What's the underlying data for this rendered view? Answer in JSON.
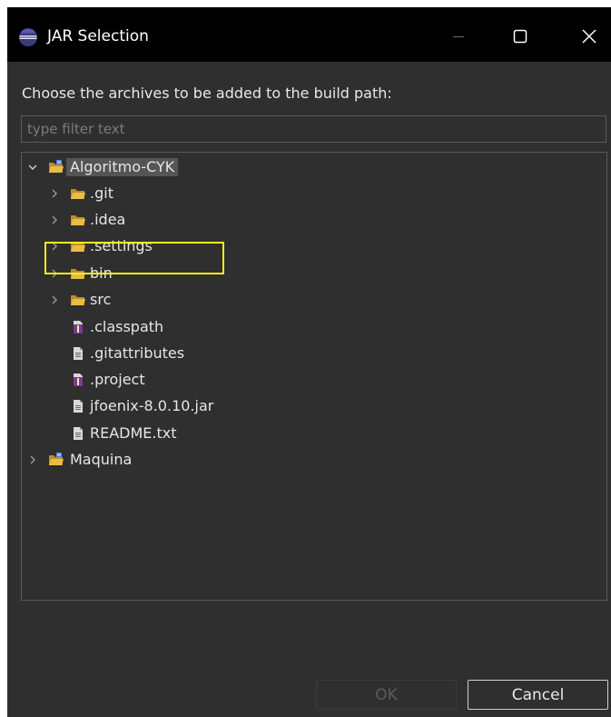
{
  "window": {
    "title": "JAR Selection",
    "minimize_icon": "minimize-icon",
    "maximize_icon": "maximize-icon",
    "close_icon": "close-icon"
  },
  "dialog": {
    "instruction": "Choose the archives to be added to the build path:",
    "filter": {
      "value": "",
      "placeholder": "type filter text"
    }
  },
  "tree": {
    "root": {
      "label": "Algoritmo-CYK",
      "expanded": true,
      "icon": "project-folder-icon"
    },
    "children": [
      {
        "label": ".git",
        "type": "folder",
        "expandable": true,
        "icon": "folder-icon"
      },
      {
        "label": ".idea",
        "type": "folder",
        "expandable": true,
        "icon": "folder-icon"
      },
      {
        "label": ".settings",
        "type": "folder",
        "expandable": true,
        "icon": "folder-icon"
      },
      {
        "label": "bin",
        "type": "folder",
        "expandable": true,
        "icon": "folder-icon"
      },
      {
        "label": "src",
        "type": "folder",
        "expandable": true,
        "icon": "folder-icon"
      },
      {
        "label": ".classpath",
        "type": "xml-file",
        "icon": "xml-file-icon"
      },
      {
        "label": ".gitattributes",
        "type": "file",
        "icon": "file-icon"
      },
      {
        "label": ".project",
        "type": "xml-file",
        "icon": "xml-file-icon"
      },
      {
        "label": "jfoenix-8.0.10.jar",
        "type": "file",
        "icon": "file-icon",
        "highlighted": true
      },
      {
        "label": "README.txt",
        "type": "file",
        "icon": "file-icon"
      }
    ],
    "second_root": {
      "label": "Maquina",
      "expanded": false,
      "icon": "project-folder-icon"
    }
  },
  "buttons": {
    "ok": {
      "label": "OK",
      "enabled": false
    },
    "cancel": {
      "label": "Cancel",
      "enabled": true
    }
  },
  "colors": {
    "title_bar": "#000000",
    "background": "#2f2f2f",
    "highlight_border": "#ffee22",
    "folder": "#e3b43a"
  }
}
